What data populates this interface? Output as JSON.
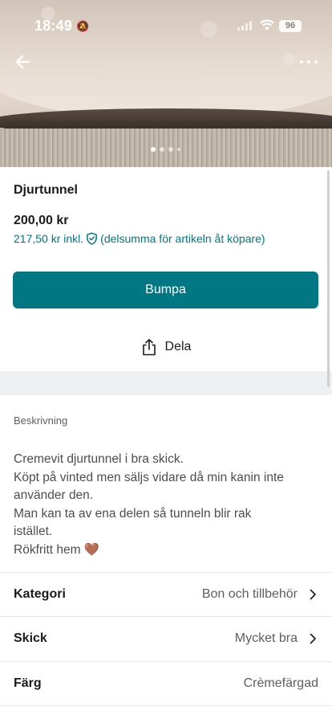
{
  "status_bar": {
    "time": "18:49",
    "battery": "96"
  },
  "listing": {
    "title": "Djurtunnel",
    "price": "200,00 kr",
    "price_incl": "217,50 kr inkl.",
    "price_incl_note": "(delsumma för artikeln åt köpare)"
  },
  "actions": {
    "bump_label": "Bumpa",
    "share_label": "Dela"
  },
  "description": {
    "label": "Beskrivning",
    "lines": [
      "Cremevit djurtunnel i bra skick.",
      "Köpt på vinted men säljs vidare då min kanin inte",
      "använder den.",
      "Man kan ta av ena delen så tunneln blir rak",
      "istället.",
      "Rökfritt hem 🤎"
    ]
  },
  "attributes": [
    {
      "label": "Kategori",
      "value": "Bon och tillbehör"
    },
    {
      "label": "Skick",
      "value": "Mycket bra"
    },
    {
      "label": "Färg",
      "value": "Crèmefärgad"
    }
  ],
  "colors": {
    "accent": "#007782",
    "band": "#eff0f1"
  },
  "icons": [
    "back-arrow-icon",
    "more-icon",
    "shield-check-icon",
    "share-icon",
    "chevron-right-icon"
  ]
}
